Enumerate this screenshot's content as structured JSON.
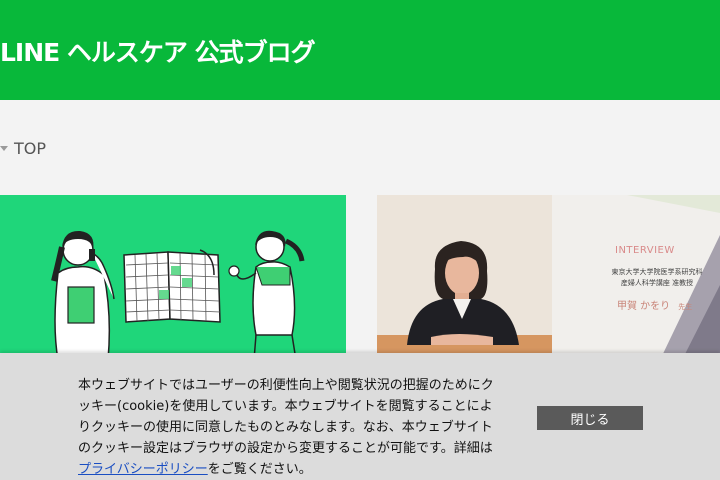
{
  "header": {
    "logo_text": "LINE ヘルスケア 公式ブログ",
    "color": "#08b83a"
  },
  "breadcrumb": {
    "items": [
      {
        "label": "TOP"
      }
    ]
  },
  "cards": [
    {
      "kind": "illustration",
      "description_icon": "women-with-calendar-illustration",
      "bg": "#1fd67a"
    },
    {
      "kind": "interview-photo",
      "interview_label": "INTERVIEW",
      "affiliation_line1": "東京大学大学院医学系研究科",
      "affiliation_line2": "産婦人科学講座 准教授",
      "name": "甲賀 かをり",
      "honorific": "先生"
    }
  ],
  "cookie_notice": {
    "text_before_link": "本ウェブサイトではユーザーの利便性向上や閲覧状況の把握のためにクッキー(cookie)を使用しています。本ウェブサイトを閲覧することによりクッキーの使用に同意したものとみなします。なお、本ウェブサイトのクッキー設定はブラウザの設定から変更することが可能です。詳細は",
    "link_text": "プライバシーポリシー",
    "text_after_link": "をご覧ください。",
    "close_label": "閉じる"
  }
}
